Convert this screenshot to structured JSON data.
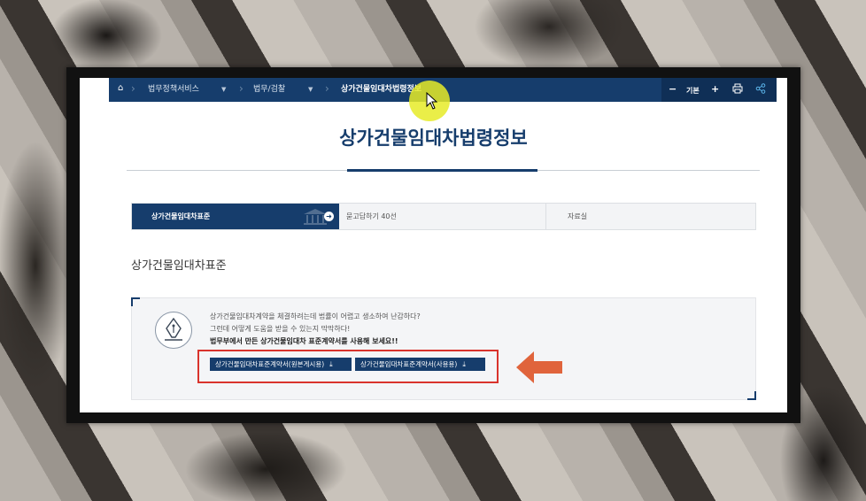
{
  "nav": {
    "breadcrumb": [
      "법무정책서비스",
      "법무/검찰",
      "상가건물임대차법령정보"
    ],
    "tools": {
      "minus": "−",
      "zoom_label": "기본",
      "plus": "+"
    }
  },
  "page_title": "상가건물임대차법령정보",
  "tabs": [
    {
      "label": "상가건물임대차표준"
    },
    {
      "label": "묻고답하기 40선"
    },
    {
      "label": "자료실"
    }
  ],
  "section_title": "상가건물임대차표준",
  "info": {
    "line1": "상가건물임대차계약을 체결하려는데 법률이 어렵고 생소하여 난감하다?",
    "line2": "그런데 어떻게 도움을 받을 수 있는지 막막하다!",
    "line3": "법무부에서 만든 상가건물임대차 표준계약서를 사용해 보세요!!"
  },
  "downloads": [
    {
      "label": "상가건물임대차표준계약서(원본게시용)"
    },
    {
      "label": "상가건물임대차표준계약서(사용용)"
    }
  ],
  "colors": {
    "primary": "#163d6c",
    "highlight": "#d9332c",
    "arrow": "#e0643c"
  }
}
